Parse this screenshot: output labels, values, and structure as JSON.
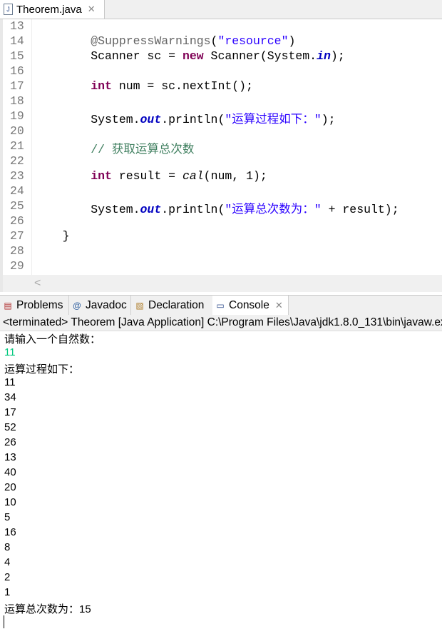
{
  "editor": {
    "tab_title": "Theorem.java",
    "tab_icon": "java-file-icon",
    "lines": [
      {
        "n": "13",
        "tokens": []
      },
      {
        "n": "14",
        "tokens": [
          [
            "ann",
            "        @SuppressWarnings"
          ],
          [
            "",
            "("
          ],
          [
            "str",
            "\"resource\""
          ],
          [
            "",
            ")"
          ]
        ]
      },
      {
        "n": "15",
        "tokens": [
          [
            "",
            "        Scanner sc = "
          ],
          [
            "kw",
            "new"
          ],
          [
            "",
            " Scanner(System."
          ],
          [
            "fld",
            "in"
          ],
          [
            "",
            ");"
          ]
        ]
      },
      {
        "n": "16",
        "tokens": []
      },
      {
        "n": "17",
        "tokens": [
          [
            "kw",
            "        int"
          ],
          [
            "",
            " num = sc.nextInt();"
          ]
        ]
      },
      {
        "n": "18",
        "tokens": []
      },
      {
        "n": "19",
        "tokens": [
          [
            "",
            "        System."
          ],
          [
            "fld",
            "out"
          ],
          [
            "",
            ".println("
          ],
          [
            "str",
            "\"运算过程如下：\""
          ],
          [
            "",
            ");"
          ]
        ]
      },
      {
        "n": "20",
        "tokens": []
      },
      {
        "n": "21",
        "tokens": [
          [
            "cm",
            "        // 获取运算总次数"
          ]
        ]
      },
      {
        "n": "22",
        "tokens": []
      },
      {
        "n": "23",
        "tokens": [
          [
            "kw",
            "        int"
          ],
          [
            "",
            " result = "
          ],
          [
            "it",
            "cal"
          ],
          [
            "",
            "(num, 1);"
          ]
        ]
      },
      {
        "n": "24",
        "tokens": []
      },
      {
        "n": "25",
        "tokens": [
          [
            "",
            "        System."
          ],
          [
            "fld",
            "out"
          ],
          [
            "",
            ".println("
          ],
          [
            "str",
            "\"运算总次数为：\""
          ],
          [
            "",
            " + result);"
          ]
        ]
      },
      {
        "n": "26",
        "tokens": []
      },
      {
        "n": "27",
        "tokens": [
          [
            "",
            "    }"
          ]
        ]
      },
      {
        "n": "28",
        "tokens": []
      },
      {
        "n": "29",
        "tokens": []
      }
    ],
    "scroll_left": "<"
  },
  "panel": {
    "tabs": [
      {
        "label": "Problems",
        "icon": "problems-icon"
      },
      {
        "label": "Javadoc",
        "icon": "javadoc-icon"
      },
      {
        "label": "Declaration",
        "icon": "declaration-icon"
      },
      {
        "label": "Console",
        "icon": "console-icon",
        "active": true
      }
    ],
    "status": "<terminated> Theorem [Java Application] C:\\Program Files\\Java\\jdk1.8.0_131\\bin\\javaw.exe",
    "output": [
      {
        "text": "请输入一个自然数："
      },
      {
        "text": "11",
        "input": true
      },
      {
        "text": "运算过程如下："
      },
      {
        "text": "11"
      },
      {
        "text": "34"
      },
      {
        "text": "17"
      },
      {
        "text": "52"
      },
      {
        "text": "26"
      },
      {
        "text": "13"
      },
      {
        "text": "40"
      },
      {
        "text": "20"
      },
      {
        "text": "10"
      },
      {
        "text": "5"
      },
      {
        "text": "16"
      },
      {
        "text": "8"
      },
      {
        "text": "4"
      },
      {
        "text": "2"
      },
      {
        "text": "1"
      },
      {
        "text": "运算总次数为：15"
      }
    ]
  },
  "colors": {
    "keyword": "#7f0055",
    "string": "#2a00ff",
    "comment": "#3f7f5f",
    "field": "#0000c0",
    "stdin": "#00c87d"
  }
}
